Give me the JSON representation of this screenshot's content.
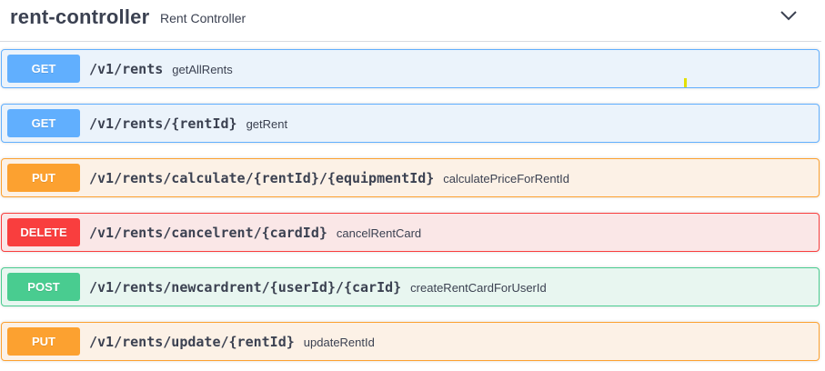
{
  "tag": {
    "name": "rent-controller",
    "description": "Rent Controller",
    "toggle_icon": "chevron-down-icon"
  },
  "operations": [
    {
      "method": "GET",
      "path": "/v1/rents",
      "summary": "getAllRents"
    },
    {
      "method": "GET",
      "path": "/v1/rents/{rentId}",
      "summary": "getRent"
    },
    {
      "method": "PUT",
      "path": "/v1/rents/calculate/{rentId}/{equipmentId}",
      "summary": "calculatePriceForRentId"
    },
    {
      "method": "DELETE",
      "path": "/v1/rents/cancelrent/{cardId}",
      "summary": "cancelRentCard"
    },
    {
      "method": "POST",
      "path": "/v1/rents/newcardrent/{userId}/{carId}",
      "summary": "createRentCardForUserId"
    },
    {
      "method": "PUT",
      "path": "/v1/rents/update/{rentId}",
      "summary": "updateRentId"
    }
  ],
  "colors": {
    "get": "#61affe",
    "put": "#fca130",
    "delete": "#f93e3e",
    "post": "#49cc90",
    "text": "#3b4151"
  }
}
